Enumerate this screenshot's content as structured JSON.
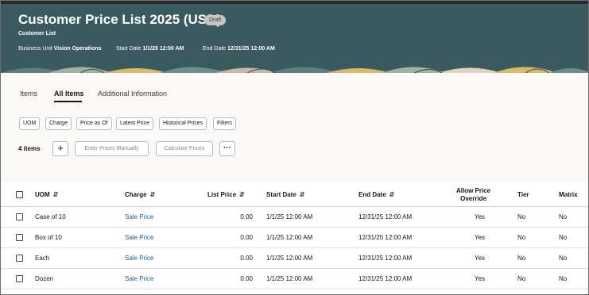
{
  "header": {
    "title": "Customer Price List 2025 (USD)",
    "status_badge": "Draft",
    "subtitle": "Customer List",
    "business_unit_label": "Business Unit",
    "business_unit_value": "Vision Operations",
    "start_date_label": "Start Date",
    "start_date_value": "1/1/25 12:00 AM",
    "end_date_label": "End Date",
    "end_date_value": "12/31/25 12:00 AM"
  },
  "tabs": [
    {
      "label": "Items",
      "active": false
    },
    {
      "label": "All Items",
      "active": true
    },
    {
      "label": "Additional Information",
      "active": false
    }
  ],
  "filters": [
    "UOM",
    "Charge",
    "Price as Of",
    "Latest Price",
    "Historical Prices",
    "Filters"
  ],
  "toolbar": {
    "item_count": "4 items",
    "add_icon": "plus-icon",
    "enter_prices_label": "Enter Prices Manually",
    "calculate_prices_label": "Calculate Prices",
    "more_icon": "more-icon"
  },
  "table": {
    "columns": {
      "uom": "UOM",
      "charge": "Charge",
      "list_price": "List Price",
      "start_date": "Start Date",
      "end_date": "End Date",
      "allow_override_1": "Allow Price",
      "allow_override_2": "Override",
      "tier": "Tier",
      "matrix": "Matrix"
    },
    "rows": [
      {
        "uom": "Case of 10",
        "charge": "Sale Price",
        "list_price": "0.00",
        "start_date": "1/1/25 12:00 AM",
        "end_date": "12/31/25 12:00 AM",
        "allow_override": "Yes",
        "tier": "No",
        "matrix": "No"
      },
      {
        "uom": "Box of 10",
        "charge": "Sale Price",
        "list_price": "0.00",
        "start_date": "1/1/25 12:00 AM",
        "end_date": "12/31/25 12:00 AM",
        "allow_override": "Yes",
        "tier": "No",
        "matrix": "No"
      },
      {
        "uom": "Each",
        "charge": "Sale Price",
        "list_price": "0.00",
        "start_date": "1/1/25 12:00 AM",
        "end_date": "12/31/25 12:00 AM",
        "allow_override": "Yes",
        "tier": "No",
        "matrix": "No"
      },
      {
        "uom": "Dozen",
        "charge": "Sale Price",
        "list_price": "0.00",
        "start_date": "1/1/25 12:00 AM",
        "end_date": "12/31/25 12:00 AM",
        "allow_override": "Yes",
        "tier": "No",
        "matrix": "No"
      }
    ]
  },
  "colors": {
    "banner": "#3a5a60",
    "link": "#1e5f88",
    "accent_yellow": "#d9b96a"
  }
}
